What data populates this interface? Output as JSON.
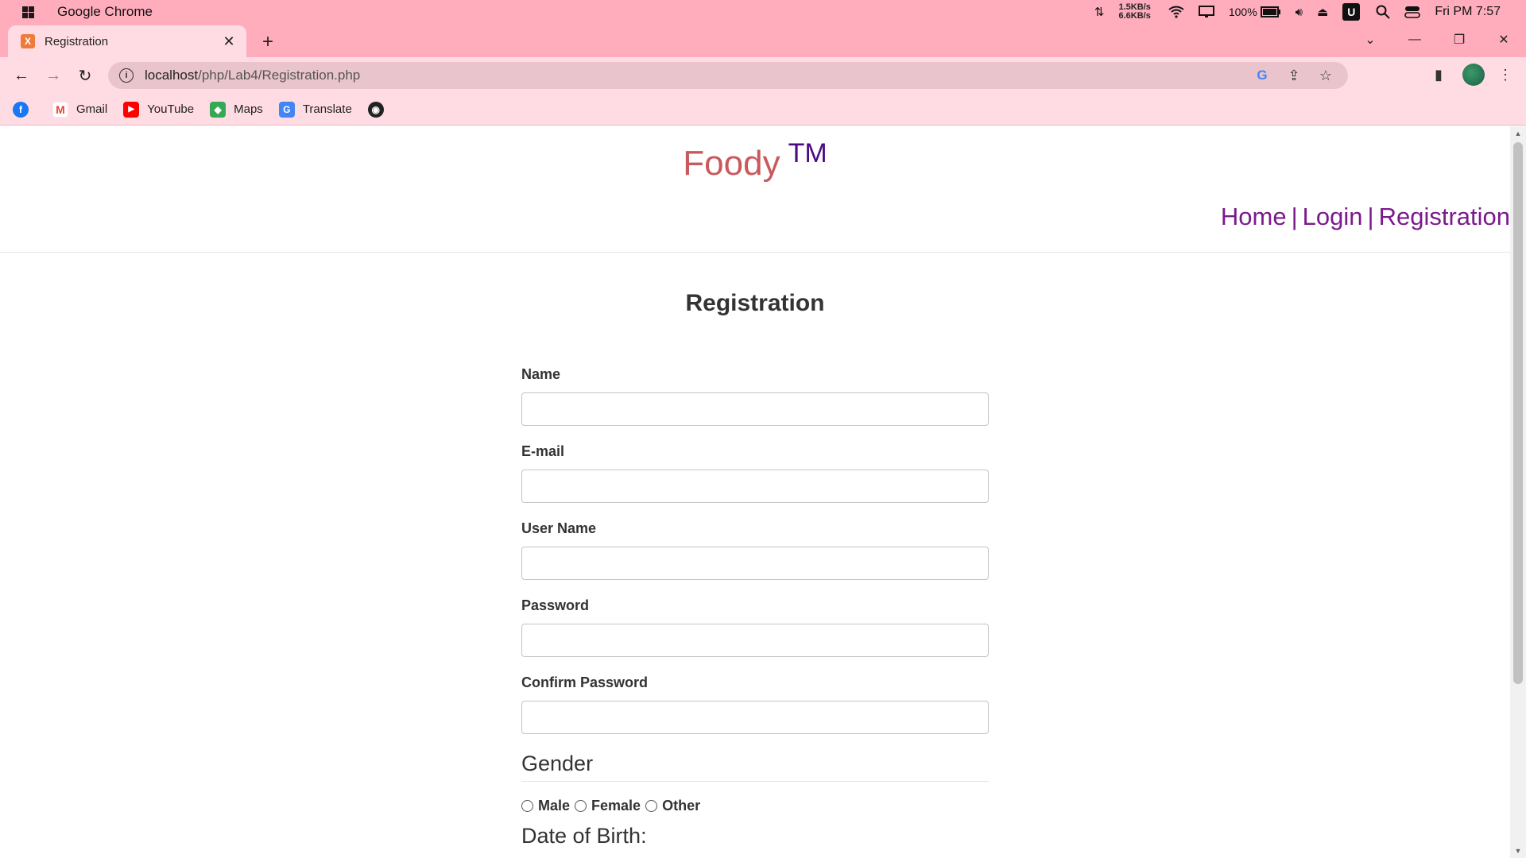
{
  "system": {
    "app_name": "Google Chrome",
    "net_up": "1.5KB/s",
    "net_down": "6.6KB/s",
    "battery": "100%",
    "clock": "Fri PM 7:57",
    "u_badge": "U"
  },
  "tab": {
    "title": "Registration",
    "favicon_letter": "X"
  },
  "toolbar": {
    "url_host": "localhost",
    "url_path": "/php/Lab4/Registration.php",
    "google_badge": "G"
  },
  "bookmarks": [
    {
      "label": ""
    },
    {
      "label": "Gmail"
    },
    {
      "label": "YouTube"
    },
    {
      "label": "Maps"
    },
    {
      "label": "Translate"
    }
  ],
  "site": {
    "brand": "Foody",
    "tm": "TM",
    "nav": {
      "home": "Home",
      "login": "Login",
      "registration": "Registration",
      "separator": "|"
    }
  },
  "form": {
    "title": "Registration",
    "fields": [
      {
        "label": "Name",
        "value": ""
      },
      {
        "label": "E-mail",
        "value": ""
      },
      {
        "label": "User Name",
        "value": ""
      },
      {
        "label": "Password",
        "value": ""
      },
      {
        "label": "Confirm Password",
        "value": ""
      }
    ],
    "gender_legend": "Gender",
    "gender_options": [
      "Male",
      "Female",
      "Other"
    ],
    "dob_legend": "Date of Birth:"
  },
  "colors": {
    "titlebar": "#ffadbd",
    "toolbar": "#ffdce3",
    "brand": "#c8595c",
    "tm": "#4b0a82",
    "nav": "#7b1a8c"
  }
}
